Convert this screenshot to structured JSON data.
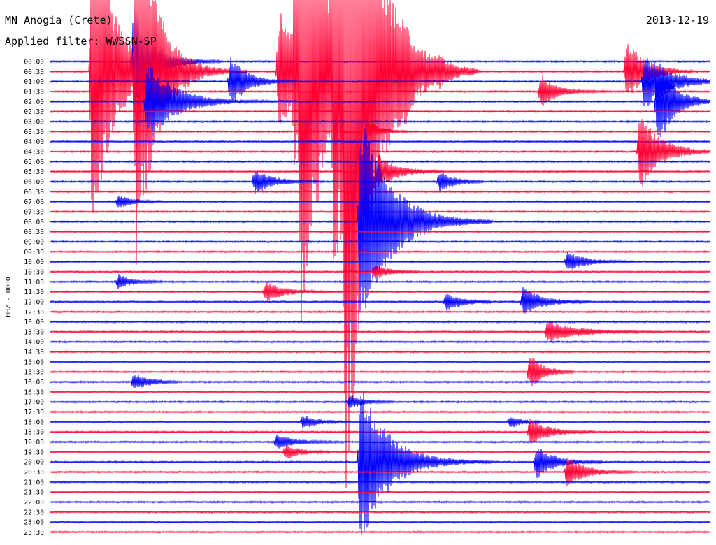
{
  "header": {
    "station": "MN Anogia (Crete)",
    "filter": "Applied filter: WWSSN-SP",
    "date": "2013-12-19"
  },
  "chart_data": {
    "type": "line",
    "chart_kind": "helicorder",
    "channel_label": "HHZ - 0000",
    "row_labels": [
      "00:00",
      "00:30",
      "01:00",
      "01:30",
      "02:00",
      "02:30",
      "03:00",
      "03:30",
      "04:00",
      "04:30",
      "05:00",
      "05:30",
      "06:00",
      "06:30",
      "07:00",
      "07:30",
      "08:00",
      "08:30",
      "09:00",
      "09:30",
      "10:00",
      "10:30",
      "11:00",
      "11:30",
      "12:00",
      "12:30",
      "13:00",
      "13:30",
      "14:00",
      "14:30",
      "15:00",
      "15:30",
      "16:00",
      "16:30",
      "17:00",
      "17:30",
      "18:00",
      "18:30",
      "19:00",
      "19:30",
      "20:00",
      "20:30",
      "21:00",
      "21:30",
      "22:00",
      "22:30",
      "23:00",
      "23:30"
    ],
    "minutes_per_row": 30,
    "colors": [
      "#0000ff",
      "#ff0033"
    ],
    "grid": false,
    "events": [
      {
        "row": 0,
        "minute": 3.8,
        "amp": 90,
        "decay": 0.8,
        "dur": 4
      },
      {
        "row": 1,
        "minute": 1.9,
        "amp": 260,
        "decay": 0.9,
        "dur": 5
      },
      {
        "row": 1,
        "minute": 3.9,
        "amp": 260,
        "decay": 0.9,
        "dur": 5
      },
      {
        "row": 4,
        "minute": 4.4,
        "amp": 60,
        "decay": 1.2,
        "dur": 8
      },
      {
        "row": 2,
        "minute": 8.2,
        "amp": 40,
        "decay": 0.7,
        "dur": 3
      },
      {
        "row": 1,
        "minute": 10.4,
        "amp": 90,
        "decay": 1.0,
        "dur": 4
      },
      {
        "row": 1,
        "minute": 11.1,
        "amp": 110,
        "decay": 1.0,
        "dur": 4
      },
      {
        "row": 1,
        "minute": 11.4,
        "amp": 250,
        "decay": 1.3,
        "dur": 5
      },
      {
        "row": 1,
        "minute": 12.9,
        "amp": 210,
        "decay": 1.1,
        "dur": 5
      },
      {
        "row": 1,
        "minute": 13.4,
        "amp": 450,
        "decay": 1.2,
        "dur": 6
      },
      {
        "row": 1,
        "minute": 16.1,
        "amp": 14,
        "decay": 0.6,
        "dur": 2
      },
      {
        "row": 1,
        "minute": 17.6,
        "amp": 10,
        "decay": 0.6,
        "dur": 2
      },
      {
        "row": 3,
        "minute": 22.3,
        "amp": 24,
        "decay": 0.7,
        "dur": 3
      },
      {
        "row": 1,
        "minute": 26.2,
        "amp": 45,
        "decay": 0.8,
        "dur": 3
      },
      {
        "row": 2,
        "minute": 27.0,
        "amp": 40,
        "decay": 1.1,
        "dur": 4
      },
      {
        "row": 4,
        "minute": 27.6,
        "amp": 70,
        "decay": 0.7,
        "dur": 3
      },
      {
        "row": 7,
        "minute": 14.5,
        "amp": 14,
        "decay": 0.5,
        "dur": 2
      },
      {
        "row": 9,
        "minute": 26.8,
        "amp": 55,
        "decay": 0.9,
        "dur": 4
      },
      {
        "row": 11,
        "minute": 14.9,
        "amp": 25,
        "decay": 0.8,
        "dur": 3
      },
      {
        "row": 12,
        "minute": 9.3,
        "amp": 18,
        "decay": 0.8,
        "dur": 3
      },
      {
        "row": 12,
        "minute": 17.7,
        "amp": 14,
        "decay": 0.7,
        "dur": 2
      },
      {
        "row": 14,
        "minute": 3.1,
        "amp": 10,
        "decay": 0.6,
        "dur": 2
      },
      {
        "row": 16,
        "minute": 14.1,
        "amp": 160,
        "decay": 1.3,
        "dur": 6
      },
      {
        "row": 21,
        "minute": 14.7,
        "amp": 10,
        "decay": 0.7,
        "dur": 2
      },
      {
        "row": 20,
        "minute": 23.5,
        "amp": 14,
        "decay": 0.8,
        "dur": 3
      },
      {
        "row": 22,
        "minute": 3.1,
        "amp": 10,
        "decay": 0.6,
        "dur": 2
      },
      {
        "row": 23,
        "minute": 9.8,
        "amp": 14,
        "decay": 0.8,
        "dur": 3
      },
      {
        "row": 24,
        "minute": 18.0,
        "amp": 14,
        "decay": 0.7,
        "dur": 2
      },
      {
        "row": 24,
        "minute": 21.5,
        "amp": 22,
        "decay": 0.8,
        "dur": 3
      },
      {
        "row": 27,
        "minute": 22.6,
        "amp": 16,
        "decay": 1.3,
        "dur": 5
      },
      {
        "row": 32,
        "minute": 3.8,
        "amp": 12,
        "decay": 0.7,
        "dur": 2
      },
      {
        "row": 31,
        "minute": 21.8,
        "amp": 24,
        "decay": 0.6,
        "dur": 2
      },
      {
        "row": 34,
        "minute": 13.6,
        "amp": 10,
        "decay": 0.6,
        "dur": 2
      },
      {
        "row": 36,
        "minute": 11.5,
        "amp": 10,
        "decay": 0.6,
        "dur": 2
      },
      {
        "row": 36,
        "minute": 20.9,
        "amp": 9,
        "decay": 0.5,
        "dur": 2
      },
      {
        "row": 37,
        "minute": 21.8,
        "amp": 20,
        "decay": 0.8,
        "dur": 3
      },
      {
        "row": 38,
        "minute": 10.3,
        "amp": 10,
        "decay": 0.8,
        "dur": 3
      },
      {
        "row": 39,
        "minute": 10.7,
        "amp": 10,
        "decay": 0.7,
        "dur": 2
      },
      {
        "row": 40,
        "minute": 22.1,
        "amp": 24,
        "decay": 0.8,
        "dur": 3
      },
      {
        "row": 40,
        "minute": 14.1,
        "amp": 120,
        "decay": 1.2,
        "dur": 6
      },
      {
        "row": 41,
        "minute": 23.5,
        "amp": 22,
        "decay": 0.8,
        "dur": 3
      }
    ]
  }
}
